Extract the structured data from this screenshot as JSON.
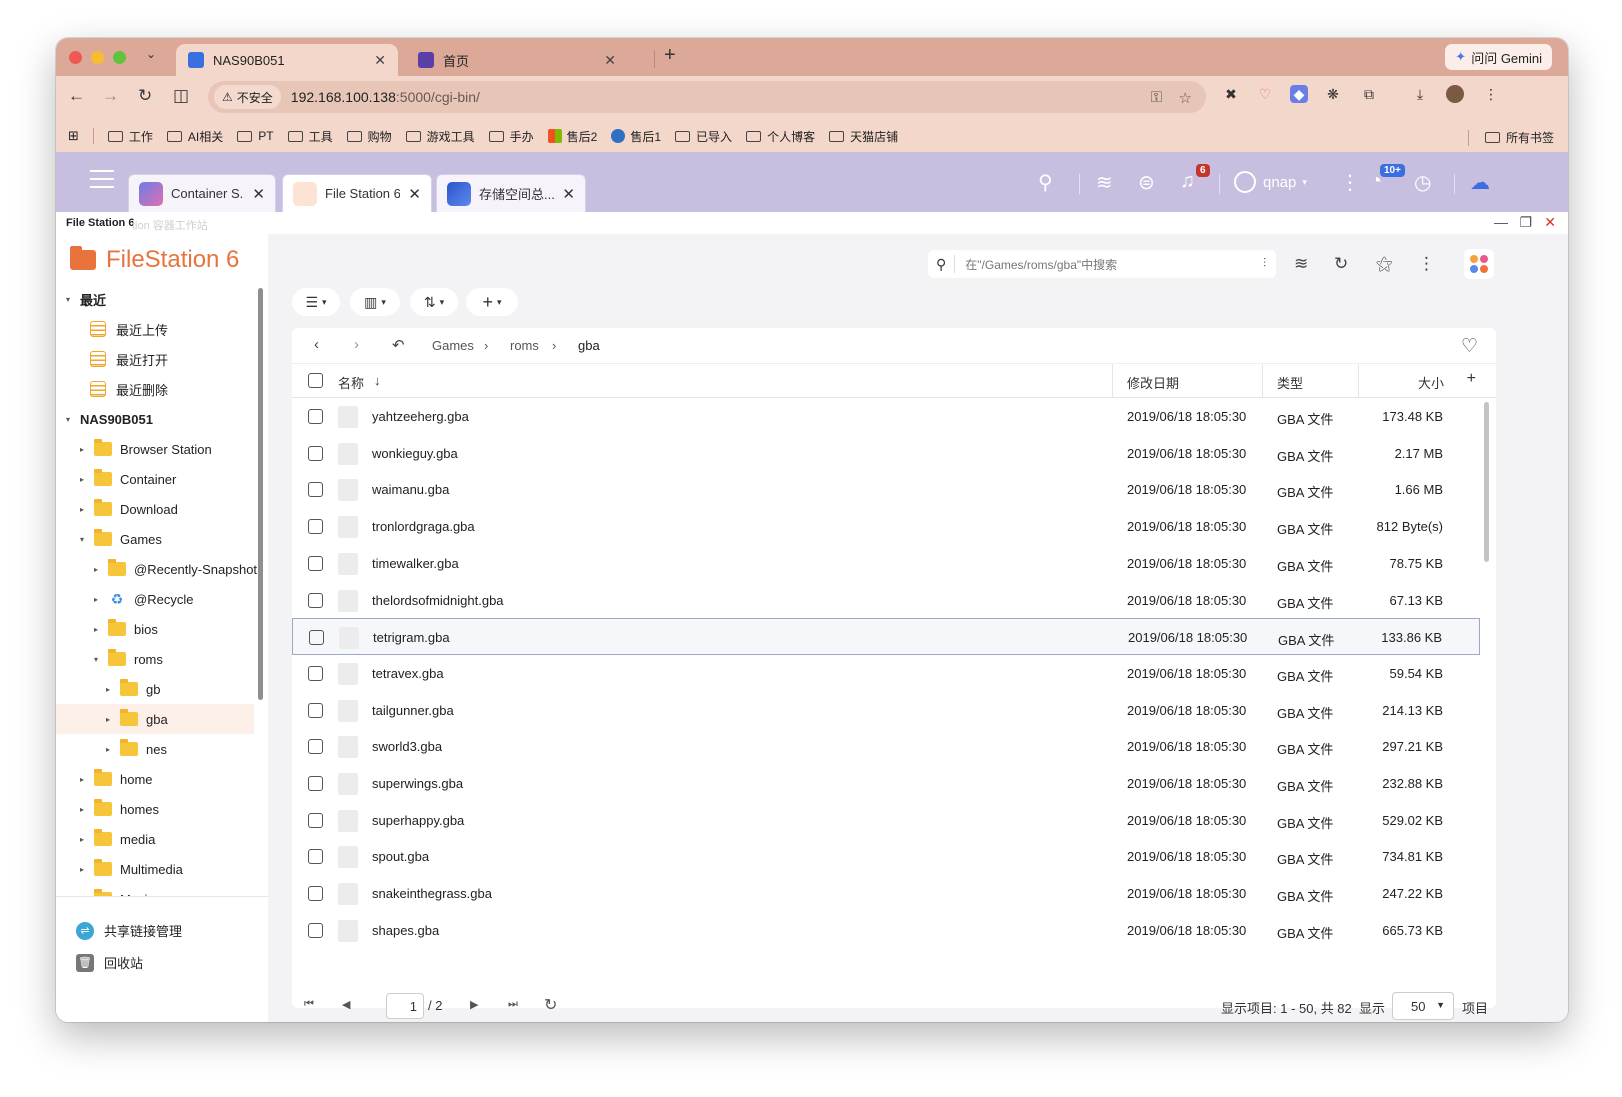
{
  "browser": {
    "tabs": [
      {
        "title": "NAS90B051",
        "close": "✕"
      },
      {
        "title": "首页",
        "close": "✕"
      }
    ],
    "new_tab": "+",
    "gemini_label": "问问 Gemini",
    "address": {
      "security_label": "不安全",
      "url_host": "192.168.100.138",
      "url_rest": ":5000/cgi-bin/"
    },
    "bookmarks": [
      "工作",
      "AI相关",
      "PT",
      "工具",
      "购物",
      "游戏工具",
      "手办",
      "售后2",
      "售后1",
      "已导入",
      "个人博客",
      "天猫店铺"
    ],
    "all_bookmarks": "所有书签"
  },
  "qnap": {
    "tabs": [
      {
        "title": "Container S...",
        "close": "✕"
      },
      {
        "title": "File Station 6",
        "close": "✕"
      },
      {
        "title": "存储空间总...",
        "close": "✕"
      }
    ],
    "notification_count": "6",
    "user": "qnap",
    "task_count": "10+"
  },
  "app": {
    "window_title": "File Station 6",
    "window_ghost": "tion 容器工作站",
    "brand": "FileStation 6"
  },
  "sidebar": {
    "tree": [
      {
        "label": "最近",
        "caret": "▾",
        "kind": "group"
      },
      {
        "label": "最近上传",
        "caret": "",
        "kind": "doc"
      },
      {
        "label": "最近打开",
        "caret": "",
        "kind": "doc"
      },
      {
        "label": "最近删除",
        "caret": "",
        "kind": "doc"
      },
      {
        "label": "NAS90B051",
        "caret": "▾",
        "kind": "group"
      },
      {
        "label": "Browser Station",
        "caret": "▸",
        "kind": "folder",
        "level": 1
      },
      {
        "label": "Container",
        "caret": "▸",
        "kind": "folder",
        "level": 1
      },
      {
        "label": "Download",
        "caret": "▸",
        "kind": "folder",
        "level": 1
      },
      {
        "label": "Games",
        "caret": "▾",
        "kind": "folder",
        "level": 1
      },
      {
        "label": "@Recently-Snapshot",
        "caret": "▸",
        "kind": "folder",
        "level": 2
      },
      {
        "label": "@Recycle",
        "caret": "▸",
        "kind": "recycle",
        "level": 2
      },
      {
        "label": "bios",
        "caret": "▸",
        "kind": "folder",
        "level": 2
      },
      {
        "label": "roms",
        "caret": "▾",
        "kind": "folder",
        "level": 2
      },
      {
        "label": "gb",
        "caret": "▸",
        "kind": "folder",
        "level": 3
      },
      {
        "label": "gba",
        "caret": "▸",
        "kind": "folder",
        "level": 3,
        "selected": true
      },
      {
        "label": "nes",
        "caret": "▸",
        "kind": "folder",
        "level": 3
      },
      {
        "label": "home",
        "caret": "▸",
        "kind": "folder",
        "level": 1
      },
      {
        "label": "homes",
        "caret": "▸",
        "kind": "folder",
        "level": 1
      },
      {
        "label": "media",
        "caret": "▸",
        "kind": "folder",
        "level": 1
      },
      {
        "label": "Multimedia",
        "caret": "▸",
        "kind": "folder",
        "level": 1
      },
      {
        "label": "Music",
        "caret": "▸",
        "kind": "folder",
        "level": 1
      }
    ],
    "share_link": "共享链接管理",
    "recycle_bin": "回收站"
  },
  "main": {
    "search_placeholder": "在\"/Games/roms/gba\"中搜索",
    "breadcrumb": [
      "Games",
      "roms",
      "gba"
    ],
    "columns": {
      "name": "名称",
      "date": "修改日期",
      "type": "类型",
      "size": "大小"
    },
    "files": [
      {
        "name": "yahtzeeherg.gba",
        "date": "2019/06/18 18:05:30",
        "type": "GBA 文件",
        "size": "173.48 KB"
      },
      {
        "name": "wonkieguy.gba",
        "date": "2019/06/18 18:05:30",
        "type": "GBA 文件",
        "size": "2.17 MB"
      },
      {
        "name": "waimanu.gba",
        "date": "2019/06/18 18:05:30",
        "type": "GBA 文件",
        "size": "1.66 MB"
      },
      {
        "name": "tronlordgraga.gba",
        "date": "2019/06/18 18:05:30",
        "type": "GBA 文件",
        "size": "812 Byte(s)"
      },
      {
        "name": "timewalker.gba",
        "date": "2019/06/18 18:05:30",
        "type": "GBA 文件",
        "size": "78.75 KB"
      },
      {
        "name": "thelordsofmidnight.gba",
        "date": "2019/06/18 18:05:30",
        "type": "GBA 文件",
        "size": "67.13 KB"
      },
      {
        "name": "tetrigram.gba",
        "date": "2019/06/18 18:05:30",
        "type": "GBA 文件",
        "size": "133.86 KB"
      },
      {
        "name": "tetravex.gba",
        "date": "2019/06/18 18:05:30",
        "type": "GBA 文件",
        "size": "59.54 KB"
      },
      {
        "name": "tailgunner.gba",
        "date": "2019/06/18 18:05:30",
        "type": "GBA 文件",
        "size": "214.13 KB"
      },
      {
        "name": "sworld3.gba",
        "date": "2019/06/18 18:05:30",
        "type": "GBA 文件",
        "size": "297.21 KB"
      },
      {
        "name": "superwings.gba",
        "date": "2019/06/18 18:05:30",
        "type": "GBA 文件",
        "size": "232.88 KB"
      },
      {
        "name": "superhappy.gba",
        "date": "2019/06/18 18:05:30",
        "type": "GBA 文件",
        "size": "529.02 KB"
      },
      {
        "name": "spout.gba",
        "date": "2019/06/18 18:05:30",
        "type": "GBA 文件",
        "size": "734.81 KB"
      },
      {
        "name": "snakeinthegrass.gba",
        "date": "2019/06/18 18:05:30",
        "type": "GBA 文件",
        "size": "247.22 KB"
      },
      {
        "name": "shapes.gba",
        "date": "2019/06/18 18:05:30",
        "type": "GBA 文件",
        "size": "665.73 KB"
      }
    ],
    "highlighted_row": 6,
    "pager": {
      "page": "1",
      "total": "/ 2",
      "summary": "显示项目: 1 - 50, 共 82",
      "show_label": "显示",
      "per_page": "50",
      "unit": "项目"
    }
  },
  "colors": {
    "accent": "#e8733d",
    "header": "#c8bedf",
    "chrome": "#f3d7cb",
    "folder": "#f7c53a"
  }
}
